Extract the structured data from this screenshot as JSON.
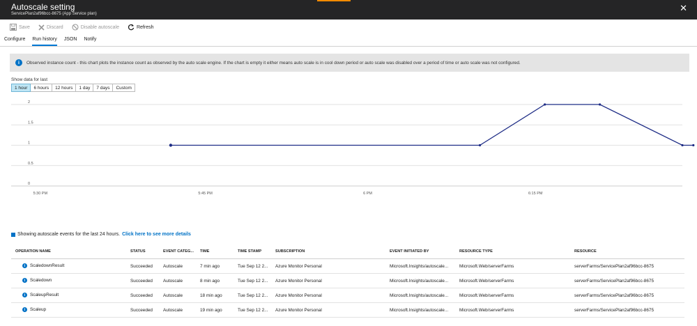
{
  "window": {
    "title": "Autoscale setting",
    "subtitle": "ServicePlan2af96bcc-8675 (App Service plan)",
    "close_icon": "close-icon"
  },
  "toolbar": {
    "save_label": "Save",
    "discard_label": "Discard",
    "disable_label": "Disable autoscale",
    "refresh_label": "Refresh"
  },
  "tabs": [
    {
      "label": "Configure"
    },
    {
      "label": "Run history"
    },
    {
      "label": "JSON"
    },
    {
      "label": "Notify"
    }
  ],
  "banner": {
    "text": "Observed instance count - this chart plots the instance count as observed by the auto scale engine. If the chart is empty it either means auto scale is in cool down period or auto scale was disabled over a period of time or auto scale was not configured."
  },
  "time_range": {
    "label": "Show data for last",
    "options": [
      "1 hour",
      "6 hours",
      "12 hours",
      "1 day",
      "7 days",
      "Custom"
    ],
    "selected": "1 hour"
  },
  "colors": {
    "line": "#1f2d86",
    "accent": "#0072c6",
    "header_bg": "#252526"
  },
  "chart_data": {
    "type": "line",
    "title": "",
    "xlabel": "",
    "ylabel": "",
    "ylim": [
      0,
      2
    ],
    "yticks": [
      "0",
      "0.5",
      "1",
      "1.5",
      "2"
    ],
    "xticks": [
      "5:30 PM",
      "5:45 PM",
      "6 PM",
      "6:15 PM"
    ],
    "xtick_minutes": [
      0,
      15,
      30,
      45
    ],
    "xlim_minutes": [
      -2,
      59
    ],
    "grid": true,
    "series": [
      {
        "x_minutes": [
          12.5,
          40.6,
          46.5,
          51.5,
          59.0,
          60.0
        ],
        "y": [
          1,
          1,
          2,
          2,
          1,
          1
        ]
      }
    ]
  },
  "events": {
    "caption": "Showing autoscale events for the last 24 hours.",
    "link": "Click here to see more details",
    "columns": [
      "OPERATION NAME",
      "STATUS",
      "EVENT CATEG...",
      "TIME",
      "TIME STAMP",
      "SUBSCRIPTION",
      "EVENT INITIATED BY",
      "RESOURCE TYPE",
      "RESOURCE"
    ],
    "rows": [
      {
        "name": "ScaledownResult",
        "status": "Succeeded",
        "category": "Autoscale",
        "time": "7 min ago",
        "stamp": "Tue Sep 12 2...",
        "subscription": "Azure Monitor Personal",
        "initiated": "Microsoft.Insights/autoscale...",
        "rtype": "Microsoft.Web/serverFarms",
        "resource": "serverFarms/ServicePlan2af96bcc-8675"
      },
      {
        "name": "Scaledown",
        "status": "Succeeded",
        "category": "Autoscale",
        "time": "8 min ago",
        "stamp": "Tue Sep 12 2...",
        "subscription": "Azure Monitor Personal",
        "initiated": "Microsoft.Insights/autoscale...",
        "rtype": "Microsoft.Web/serverFarms",
        "resource": "serverFarms/ServicePlan2af96bcc-8675"
      },
      {
        "name": "ScaleupResult",
        "status": "Succeeded",
        "category": "Autoscale",
        "time": "18 min ago",
        "stamp": "Tue Sep 12 2...",
        "subscription": "Azure Monitor Personal",
        "initiated": "Microsoft.Insights/autoscale...",
        "rtype": "Microsoft.Web/serverFarms",
        "resource": "serverFarms/ServicePlan2af96bcc-8675"
      },
      {
        "name": "Scaleup",
        "status": "Succeeded",
        "category": "Autoscale",
        "time": "19 min ago",
        "stamp": "Tue Sep 12 2...",
        "subscription": "Azure Monitor Personal",
        "initiated": "Microsoft.Insights/autoscale...",
        "rtype": "Microsoft.Web/serverFarms",
        "resource": "serverFarms/ServicePlan2af96bcc-8675"
      }
    ]
  }
}
